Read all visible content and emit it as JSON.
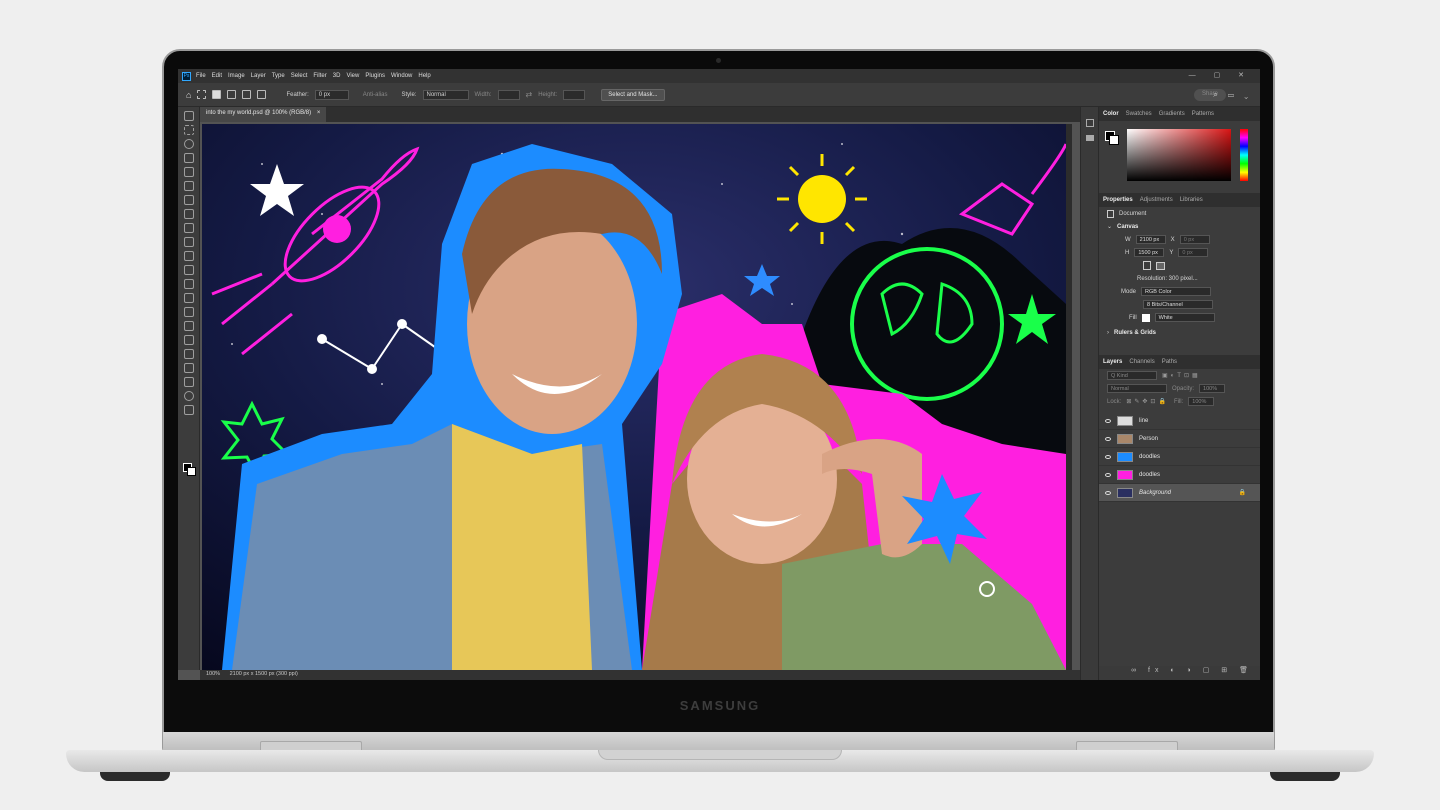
{
  "device": {
    "brand": "SAMSUNG"
  },
  "app": {
    "logo": "Ps",
    "menus": [
      "File",
      "Edit",
      "Image",
      "Layer",
      "Type",
      "Select",
      "Filter",
      "3D",
      "View",
      "Plugins",
      "Window",
      "Help"
    ],
    "window_controls": "— ▢ ✕"
  },
  "options_bar": {
    "feather_label": "Feather:",
    "feather_value": "0 px",
    "anti_alias_label": "Anti-alias",
    "style_label": "Style:",
    "style_value": "Normal",
    "width_label": "Width:",
    "height_label": "Height:",
    "select_mask_label": "Select and Mask...",
    "share_label": "Share",
    "top_icons": "⌕ ▭ ⌄"
  },
  "document": {
    "tab_title": "into the my world.psd @ 100% (RGB/8)",
    "tab_close": "×",
    "status_zoom": "100%",
    "status_info": "2100 px x 1500 px (300 ppi)"
  },
  "color_panel": {
    "tabs": [
      "Color",
      "Swatches",
      "Gradients",
      "Patterns"
    ],
    "accent": "#d81414"
  },
  "properties_panel": {
    "tabs": [
      "Properties",
      "Adjustments",
      "Libraries"
    ],
    "doc_label": "Document",
    "canvas_heading": "Canvas",
    "w_label": "W",
    "w_value": "2100 px",
    "x_label": "X",
    "x_value": "0 px",
    "h_label": "H",
    "h_value": "1500 px",
    "y_label": "Y",
    "y_value": "0 px",
    "resolution": "Resolution: 300 pixel...",
    "mode_label": "Mode",
    "mode_value": "RGB Color",
    "bits_value": "8 Bits/Channel",
    "fill_label": "Fill",
    "fill_value": "White",
    "rulers_heading": "Rulers & Grids"
  },
  "layers_panel": {
    "tabs": [
      "Layers",
      "Channels",
      "Paths"
    ],
    "kind_placeholder": "Q Kind",
    "blend_mode": "Normal",
    "opacity_label": "Opacity:",
    "opacity_value": "100%",
    "lock_label": "Lock:",
    "fill_label": "Fill:",
    "fill_value": "100%",
    "layers": [
      {
        "name": "line"
      },
      {
        "name": "Person"
      },
      {
        "name": "doodles"
      },
      {
        "name": "doodles"
      },
      {
        "name": "Background"
      }
    ],
    "footer_icons": "∞ fx ◐ ◑ ▢ ⊞ 🗑"
  }
}
